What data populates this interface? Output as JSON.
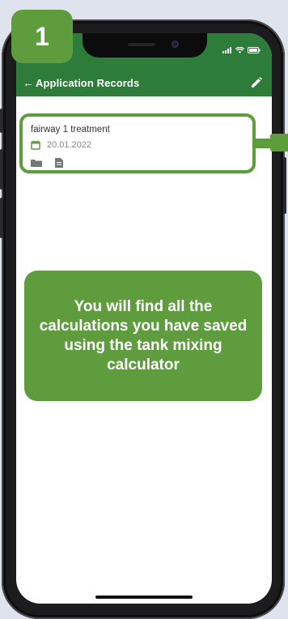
{
  "step": {
    "number": "1"
  },
  "app_bar": {
    "back_icon": "arrow-left-icon",
    "title": "Application Records",
    "edit_icon": "pencil-icon"
  },
  "record": {
    "name": "fairway 1 treatment",
    "date": "20.01.2022",
    "date_icon": "calendar-icon",
    "actions": [
      "folder-icon",
      "document-icon"
    ]
  },
  "callout": {
    "text": "You will find all the calculations you have saved using the tank mixing calculator"
  },
  "colors": {
    "app_bar": "#2e7c3a",
    "accent": "#5e9c3e",
    "background": "#dfe3ee"
  }
}
